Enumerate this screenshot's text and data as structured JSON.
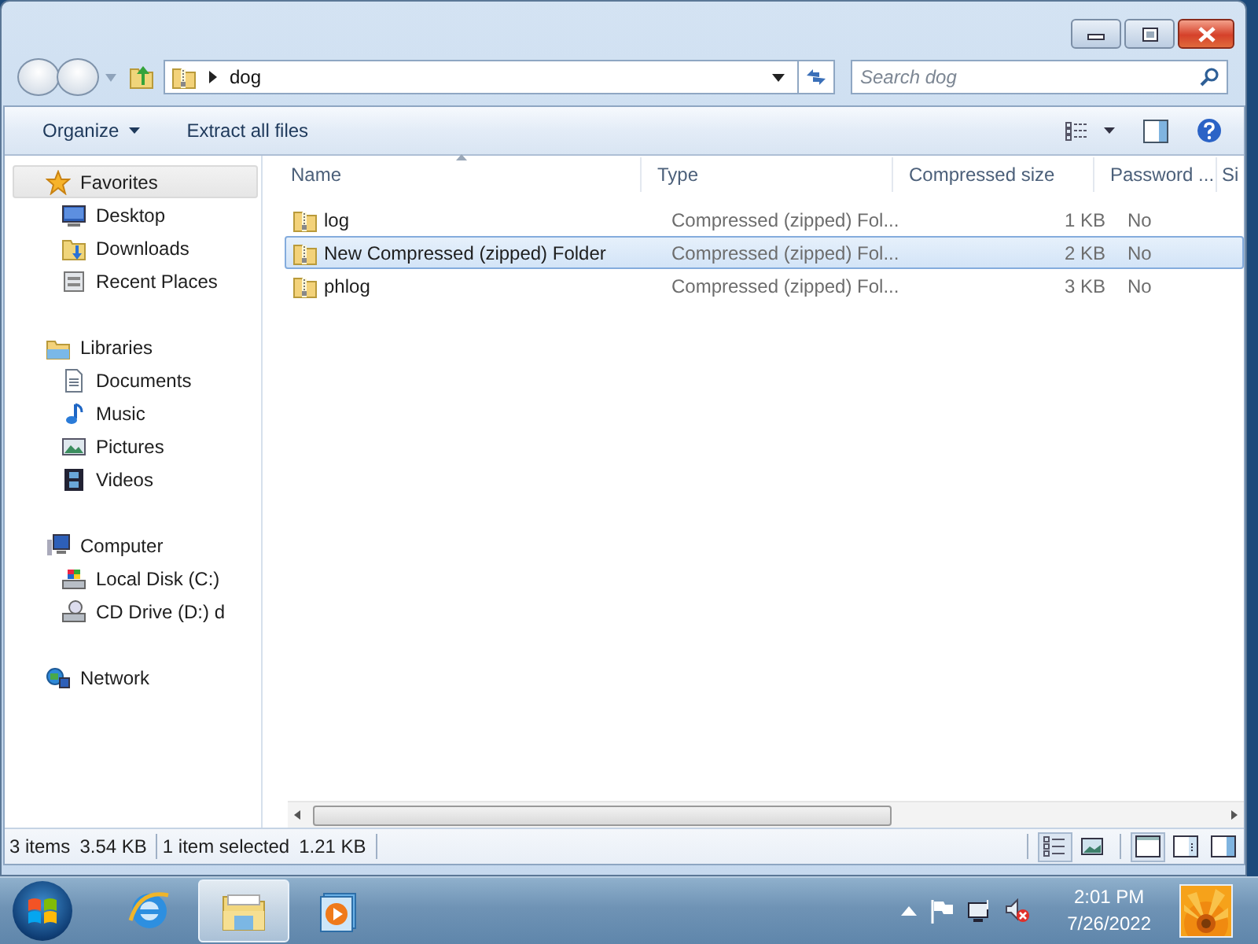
{
  "window": {
    "caption_buttons": [
      {
        "kind": "minimize",
        "hovered": false
      },
      {
        "kind": "maximize",
        "hovered": false
      },
      {
        "kind": "close",
        "hovered": true
      }
    ],
    "address_path": [
      "dog"
    ],
    "search": {
      "placeholder": "Search dog"
    }
  },
  "toolbar": {
    "buttons": [
      {
        "label": "Organize",
        "kind": "menu"
      },
      {
        "label": "Extract all files",
        "kind": "plain"
      }
    ]
  },
  "nav_pane": {
    "groups": [
      {
        "label": "Favorites",
        "kind": "star",
        "selected": true,
        "children": [
          {
            "label": "Desktop",
            "kind": "desktop",
            "selected": false
          },
          {
            "label": "Downloads",
            "kind": "downloads",
            "selected": false
          },
          {
            "label": "Recent Places",
            "kind": "recent",
            "selected": false
          }
        ]
      },
      {
        "label": "Libraries",
        "kind": "library",
        "selected": false,
        "children": [
          {
            "label": "Documents",
            "kind": "document",
            "selected": false
          },
          {
            "label": "Music",
            "kind": "music",
            "selected": false
          },
          {
            "label": "Pictures",
            "kind": "pictures",
            "selected": false
          },
          {
            "label": "Videos",
            "kind": "videos",
            "selected": false
          }
        ]
      },
      {
        "label": "Computer",
        "kind": "computer",
        "selected": false,
        "children": [
          {
            "label": "Local Disk (C:)",
            "kind": "disk",
            "selected": false
          },
          {
            "label": "CD Drive (D:) d",
            "kind": "cd",
            "selected": false
          }
        ]
      },
      {
        "label": "Network",
        "kind": "network",
        "selected": false
      }
    ]
  },
  "file_list": {
    "columns": [
      "Name",
      "Type",
      "Compressed size",
      "Password ...",
      "Si"
    ],
    "rows": [
      {
        "name": "log",
        "type": "Compressed (zipped) Fol...",
        "compressed_size": "1 KB",
        "password": "No",
        "selected": false
      },
      {
        "name": "New Compressed (zipped) Folder",
        "type": "Compressed (zipped) Fol...",
        "compressed_size": "2 KB",
        "password": "No",
        "selected": true
      },
      {
        "name": "phlog",
        "type": "Compressed (zipped) Fol...",
        "compressed_size": "3 KB",
        "password": "No",
        "selected": false
      }
    ]
  },
  "status_bar": {
    "segments": [
      {
        "count": "3 items",
        "size": "3.54 KB"
      },
      {
        "count": "1 item selected",
        "size": "1.21 KB"
      }
    ],
    "view_buttons": [
      {
        "kind": "details",
        "selected": true
      },
      {
        "kind": "large-icons",
        "selected": false
      }
    ],
    "layout_buttons": [
      {
        "kind": "no-pane",
        "selected": true
      },
      {
        "kind": "details-pane",
        "selected": false
      },
      {
        "kind": "preview-pane",
        "selected": false
      }
    ]
  },
  "taskbar": {
    "apps": [
      {
        "kind": "browser",
        "selected": false
      },
      {
        "kind": "explorer",
        "selected": true
      },
      {
        "kind": "media",
        "selected": false
      }
    ],
    "tray": {
      "time": "2:01 PM",
      "date": "7/26/2022"
    }
  }
}
